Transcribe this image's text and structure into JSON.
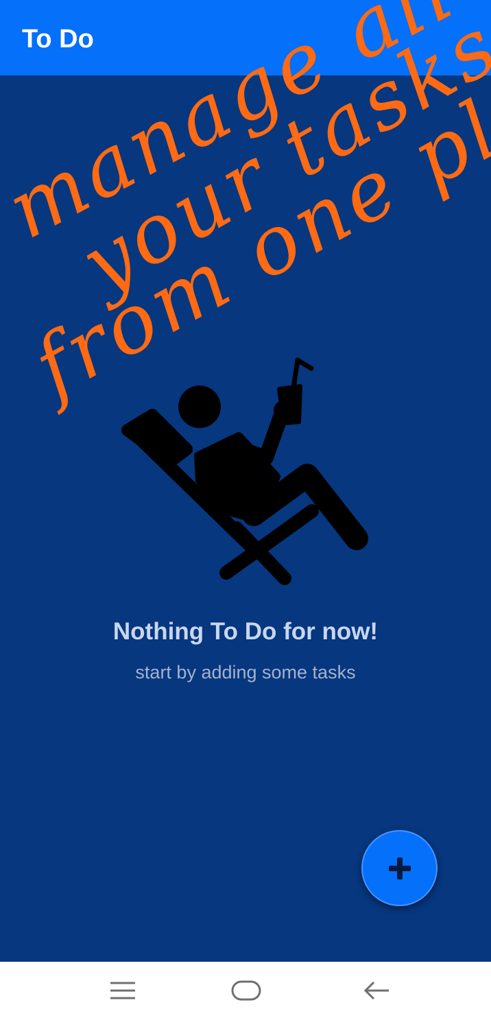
{
  "app_bar": {
    "title": "To Do",
    "color": "#0570f9"
  },
  "background_color": "#06377f",
  "promo": {
    "line1": "manage all",
    "line2": "your tasks",
    "line3": "from one place",
    "color": "#ff6a13"
  },
  "empty_state": {
    "illustration_icon": "relaxing-person-in-deck-chair-icon",
    "title": "Nothing To Do for now!",
    "subtitle": "start by adding some tasks"
  },
  "fab": {
    "icon": "plus-icon"
  },
  "nav_bar": {
    "items": [
      {
        "icon": "menu-icon"
      },
      {
        "icon": "home-icon"
      },
      {
        "icon": "back-arrow-icon"
      }
    ]
  }
}
